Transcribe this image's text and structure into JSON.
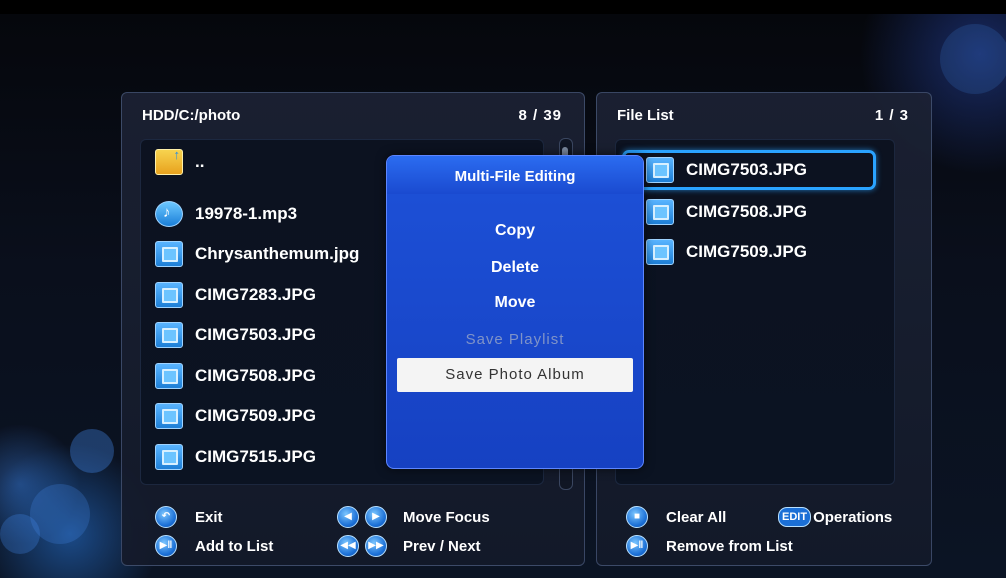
{
  "left_panel": {
    "path": "HDD/C:/photo",
    "count": "8 / 39",
    "files": [
      {
        "name": "..",
        "icon": "folder-up-icon"
      },
      {
        "name": "19978-1.mp3",
        "icon": "music-file-icon"
      },
      {
        "name": "Chrysanthemum.jpg",
        "icon": "photo-file-icon"
      },
      {
        "name": "CIMG7283.JPG",
        "icon": "photo-file-icon"
      },
      {
        "name": "CIMG7503.JPG",
        "icon": "photo-file-icon"
      },
      {
        "name": "CIMG7508.JPG",
        "icon": "photo-file-icon"
      },
      {
        "name": "CIMG7509.JPG",
        "icon": "photo-file-icon"
      },
      {
        "name": "CIMG7515.JPG",
        "icon": "photo-file-icon"
      }
    ]
  },
  "right_panel": {
    "title": "File List",
    "count": "1 / 3",
    "files": [
      {
        "name": "CIMG7503.JPG",
        "icon": "photo-file-icon",
        "selected": true
      },
      {
        "name": "CIMG7508.JPG",
        "icon": "photo-file-icon"
      },
      {
        "name": "CIMG7509.JPG",
        "icon": "photo-file-icon"
      }
    ]
  },
  "dialog": {
    "title": "Multi-File Editing",
    "items": [
      {
        "label": "Copy",
        "state": "enabled"
      },
      {
        "label": "Delete",
        "state": "enabled"
      },
      {
        "label": "Move",
        "state": "enabled"
      },
      {
        "label": "Save Playlist",
        "state": "disabled"
      },
      {
        "label": "Save Photo Album",
        "state": "selected"
      }
    ]
  },
  "legend_left": [
    {
      "label": "Exit",
      "icon": "return-button-icon"
    },
    {
      "label": "Add to List",
      "icon": "play-pause-button-icon"
    },
    {
      "label": "Move Focus",
      "icon": "left-right-arrow-buttons-icon"
    },
    {
      "label": "Prev / Next",
      "icon": "skip-prev-next-buttons-icon"
    }
  ],
  "legend_right": [
    {
      "label": "Clear All",
      "icon": "stop-button-icon"
    },
    {
      "label": "Operations",
      "icon": "edit-button-icon",
      "icon_text": "EDIT"
    },
    {
      "label": "Remove from List",
      "icon": "play-pause-button-icon"
    }
  ],
  "colors": {
    "dialog_bg": "#1641c2",
    "selection_border": "#2aa3ff",
    "selected_item_bg": "#f4f4f4",
    "disabled_text": "#7f93c8"
  }
}
